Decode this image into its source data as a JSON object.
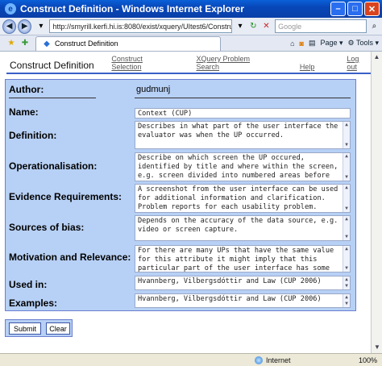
{
  "window": {
    "title": "Construct Definition - Windows Internet Explorer",
    "url": "http://smyrill.kerfi.hi.is:8080/exist/xquery/UItest6/Construct.xq",
    "search_placeholder": "Google",
    "tab_title": "Construct Definition",
    "page_menu": "Page",
    "tools_menu": "Tools",
    "status_zone": "Internet",
    "zoom": "100%"
  },
  "header": {
    "title": "Construct Definition",
    "links": [
      "Construct Selection",
      "XQuery Problem Search",
      "Help",
      "Log out"
    ]
  },
  "form": {
    "author_label": "Author:",
    "author_value": "gudmunj",
    "name_label": "Name:",
    "name_value": "Context (CUP)",
    "definition_label": "Definition:",
    "definition_value": "Describes in what part of the user interface the evaluator was when the UP occurred.",
    "operationalisation_label": "Operationalisation:",
    "operationalisation_value": "Describe on which screen the UP occured, identified by title and where within the screen, e.g. screen divided into numbered areas before",
    "evidence_label": "Evidence Requirements:",
    "evidence_value": "A screenshot from the user interface can be used for additional information and clarification. Problem reports for each usability problem.",
    "bias_label": "Sources of bias:",
    "bias_value": "Depends on the accuracy of the data source, e.g. video or screen capture.",
    "motivation_label": "Motivation and Relevance:",
    "motivation_value": "For there are many UPs that have the same value for this attribute it might imply that this particular part of the user interface has some",
    "usedin_label": "Used in:",
    "usedin_value": "Hvannberg, Vilbergsdóttir and Law (CUP 2006)",
    "examples_label": "Examples:",
    "examples_value": "Hvannberg, Vilbergsdóttir and Law (CUP 2006)"
  },
  "buttons": {
    "submit": "Submit",
    "clear": "Clear"
  }
}
